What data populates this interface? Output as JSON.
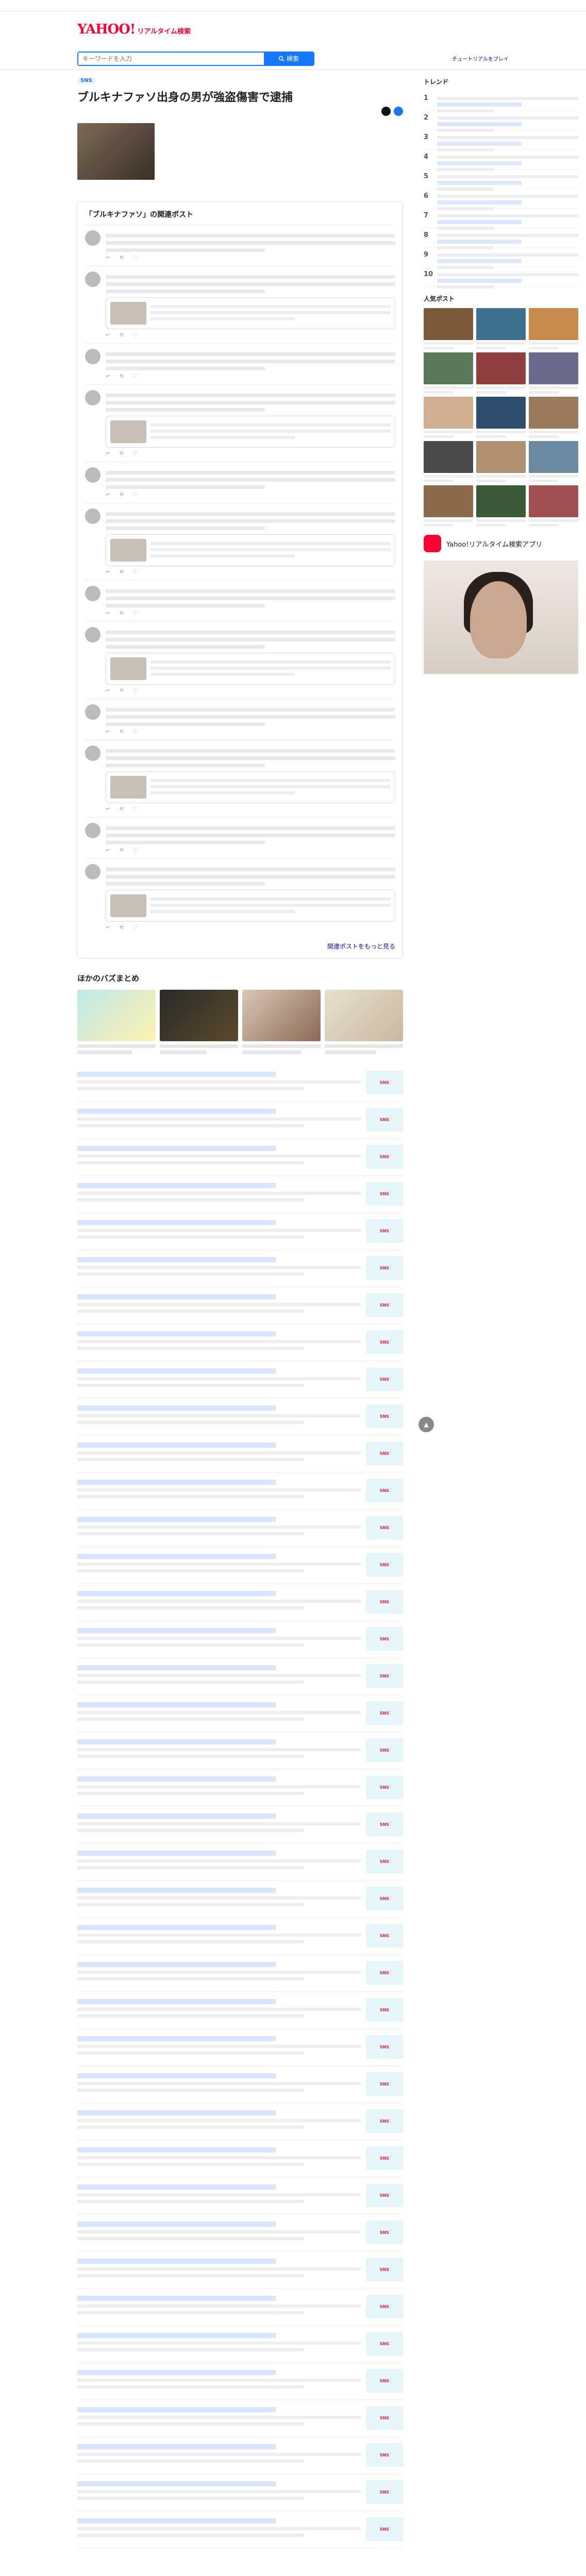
{
  "top": {
    "notice": "",
    "links": [
      "",
      "",
      ""
    ]
  },
  "header": {
    "brand_main": "YAHOO!",
    "brand_sub": "リアルタイム検索",
    "tagline": "",
    "tagline2": ""
  },
  "search": {
    "placeholder": "キーワードを入力",
    "button_label": "検索",
    "tutorial_label": "チュートリアルをプレイ"
  },
  "article": {
    "badge": "SNS",
    "category": "",
    "title": "ブルキナファソ出身の男が強盗傷害で逮捕",
    "date": "",
    "lead": "",
    "source": "",
    "disclaimer": ""
  },
  "related": {
    "heading": "「ブルキナファソ」の関連ポスト",
    "posts": [
      {
        "name": ""
      },
      {
        "name": ""
      },
      {
        "name": ""
      },
      {
        "name": ""
      },
      {
        "name": ""
      },
      {
        "name": ""
      },
      {
        "name": ""
      },
      {
        "name": ""
      },
      {
        "name": ""
      },
      {
        "name": ""
      },
      {
        "name": ""
      },
      {
        "name": ""
      }
    ],
    "more": "関連ポストをもっと見る"
  },
  "others": {
    "heading": "ほかのバズまとめ",
    "cards": [
      {
        "title": ""
      },
      {
        "title": ""
      },
      {
        "title": ""
      },
      {
        "title": ""
      }
    ]
  },
  "list": [
    {
      "title": ""
    },
    {
      "title": ""
    },
    {
      "title": ""
    },
    {
      "title": ""
    },
    {
      "title": ""
    },
    {
      "title": ""
    },
    {
      "title": ""
    },
    {
      "title": ""
    },
    {
      "title": ""
    },
    {
      "title": ""
    },
    {
      "title": ""
    },
    {
      "title": ""
    },
    {
      "title": ""
    },
    {
      "title": ""
    },
    {
      "title": ""
    },
    {
      "title": ""
    },
    {
      "title": ""
    },
    {
      "title": ""
    },
    {
      "title": ""
    },
    {
      "title": ""
    },
    {
      "title": ""
    },
    {
      "title": ""
    },
    {
      "title": ""
    },
    {
      "title": ""
    },
    {
      "title": ""
    },
    {
      "title": ""
    },
    {
      "title": ""
    },
    {
      "title": ""
    },
    {
      "title": ""
    },
    {
      "title": ""
    },
    {
      "title": ""
    },
    {
      "title": ""
    },
    {
      "title": ""
    },
    {
      "title": ""
    },
    {
      "title": ""
    },
    {
      "title": ""
    },
    {
      "title": ""
    },
    {
      "title": ""
    },
    {
      "title": ""
    },
    {
      "title": ""
    }
  ],
  "sidebar": {
    "trend_heading": "トレンド",
    "trend_sub": "",
    "trends": [
      {
        "rank": "1",
        "label": ""
      },
      {
        "rank": "2",
        "label": ""
      },
      {
        "rank": "3",
        "label": ""
      },
      {
        "rank": "4",
        "label": ""
      },
      {
        "rank": "5",
        "label": ""
      },
      {
        "rank": "6",
        "label": ""
      },
      {
        "rank": "7",
        "label": ""
      },
      {
        "rank": "8",
        "label": ""
      },
      {
        "rank": "9",
        "label": ""
      },
      {
        "rank": "10",
        "label": ""
      }
    ],
    "more_trends": "",
    "popular_heading": "人気ポスト",
    "app_label": "Yahoo!リアルタイム検索アプリ"
  }
}
